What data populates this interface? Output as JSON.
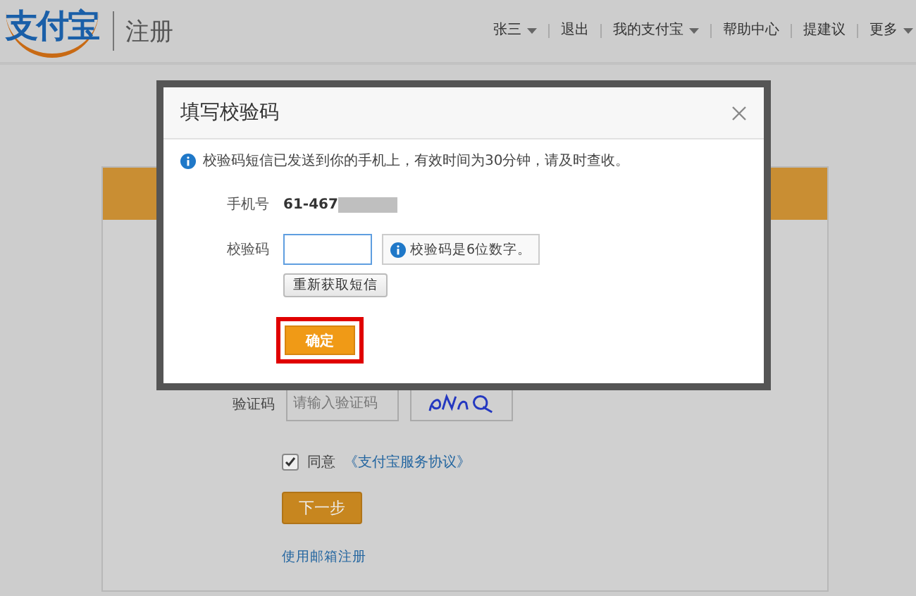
{
  "header": {
    "logo": "支付宝",
    "page_title": "注册",
    "nav": [
      {
        "label": "张三",
        "dropdown": true
      },
      {
        "label": "退出",
        "dropdown": false
      },
      {
        "label": "我的支付宝",
        "dropdown": true
      },
      {
        "label": "帮助中心",
        "dropdown": false
      },
      {
        "label": "提建议",
        "dropdown": false
      },
      {
        "label": "更多",
        "dropdown": true
      }
    ]
  },
  "form": {
    "captcha_label": "验证码",
    "captcha_input": {
      "placeholder": "请输入验证码"
    },
    "agree": {
      "checked": true,
      "label": "同意",
      "link": "《支付宝服务协议》"
    },
    "next_button": "下一步",
    "email_link": "使用邮箱注册"
  },
  "dialog": {
    "title": "填写校验码",
    "notice": "校验码短信已发送到你的手机上，有效时间为30分钟，请及时查收。",
    "phone_label": "手机号",
    "phone_value": "61-467",
    "code_label": "校验码",
    "code_tip": "校验码是6位数字。",
    "resend_button": "重新获取短信",
    "confirm_button": {
      "label": "确定",
      "highlighted": true
    }
  }
}
